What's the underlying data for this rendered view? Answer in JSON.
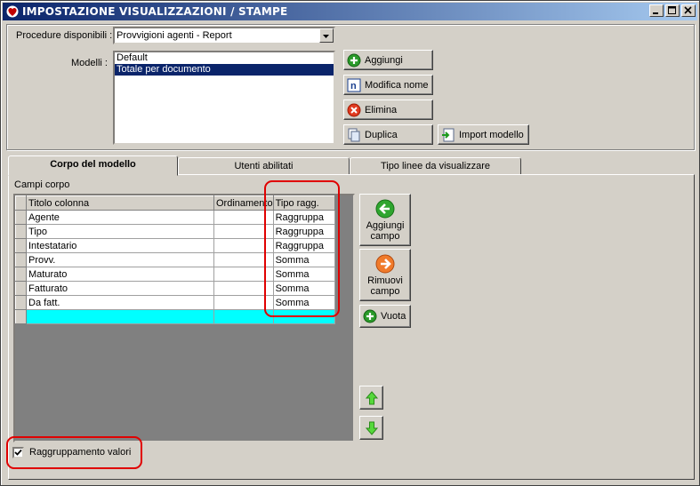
{
  "window": {
    "title": "IMPOSTAZIONE VISUALIZZAZIONI / STAMPE",
    "icon": "app-heart-icon",
    "controls": [
      "minimize-icon",
      "maximize-icon",
      "close-icon"
    ]
  },
  "top": {
    "procedure_label": "Procedure disponibili :",
    "procedure_value": "Provvigioni agenti - Report",
    "models_label": "Modelli :",
    "models": [
      {
        "label": "Default",
        "selected": false
      },
      {
        "label": "Totale per documento",
        "selected": true
      }
    ],
    "buttons": {
      "add": "Aggiungi",
      "rename": "Modifica nome",
      "delete": "Elimina",
      "duplicate": "Duplica",
      "import": "Import modello"
    }
  },
  "tabs": [
    {
      "label": "Corpo del modello",
      "active": true
    },
    {
      "label": "Utenti abilitati",
      "active": false
    },
    {
      "label": "Tipo linee da visualizzare",
      "active": false
    }
  ],
  "body": {
    "section_label": "Campi corpo",
    "columns": [
      "Titolo colonna",
      "Ordinamento",
      "Tipo ragg."
    ],
    "rows": [
      {
        "title": "Agente",
        "order": "",
        "type": "Raggruppa"
      },
      {
        "title": "Tipo",
        "order": "",
        "type": "Raggruppa"
      },
      {
        "title": "Intestatario",
        "order": "",
        "type": "Raggruppa"
      },
      {
        "title": "Provv.",
        "order": "",
        "type": "Somma"
      },
      {
        "title": "Maturato",
        "order": "",
        "type": "Somma"
      },
      {
        "title": "Fatturato",
        "order": "",
        "type": "Somma"
      },
      {
        "title": "Da fatt.",
        "order": "",
        "type": "Somma"
      }
    ],
    "side_buttons": {
      "add_field_line1": "Aggiungi",
      "add_field_line2": "campo",
      "remove_field_line1": "Rimuovi",
      "remove_field_line2": "campo",
      "empty": "Vuota"
    },
    "checkbox_label": "Raggruppamento valori",
    "checkbox_checked": true
  },
  "colors": {
    "title_start": "#0a246a",
    "title_end": "#a6caf0",
    "highlight_box": "#e00000",
    "new_row": "#00ffff",
    "face": "#d4d0c8"
  }
}
